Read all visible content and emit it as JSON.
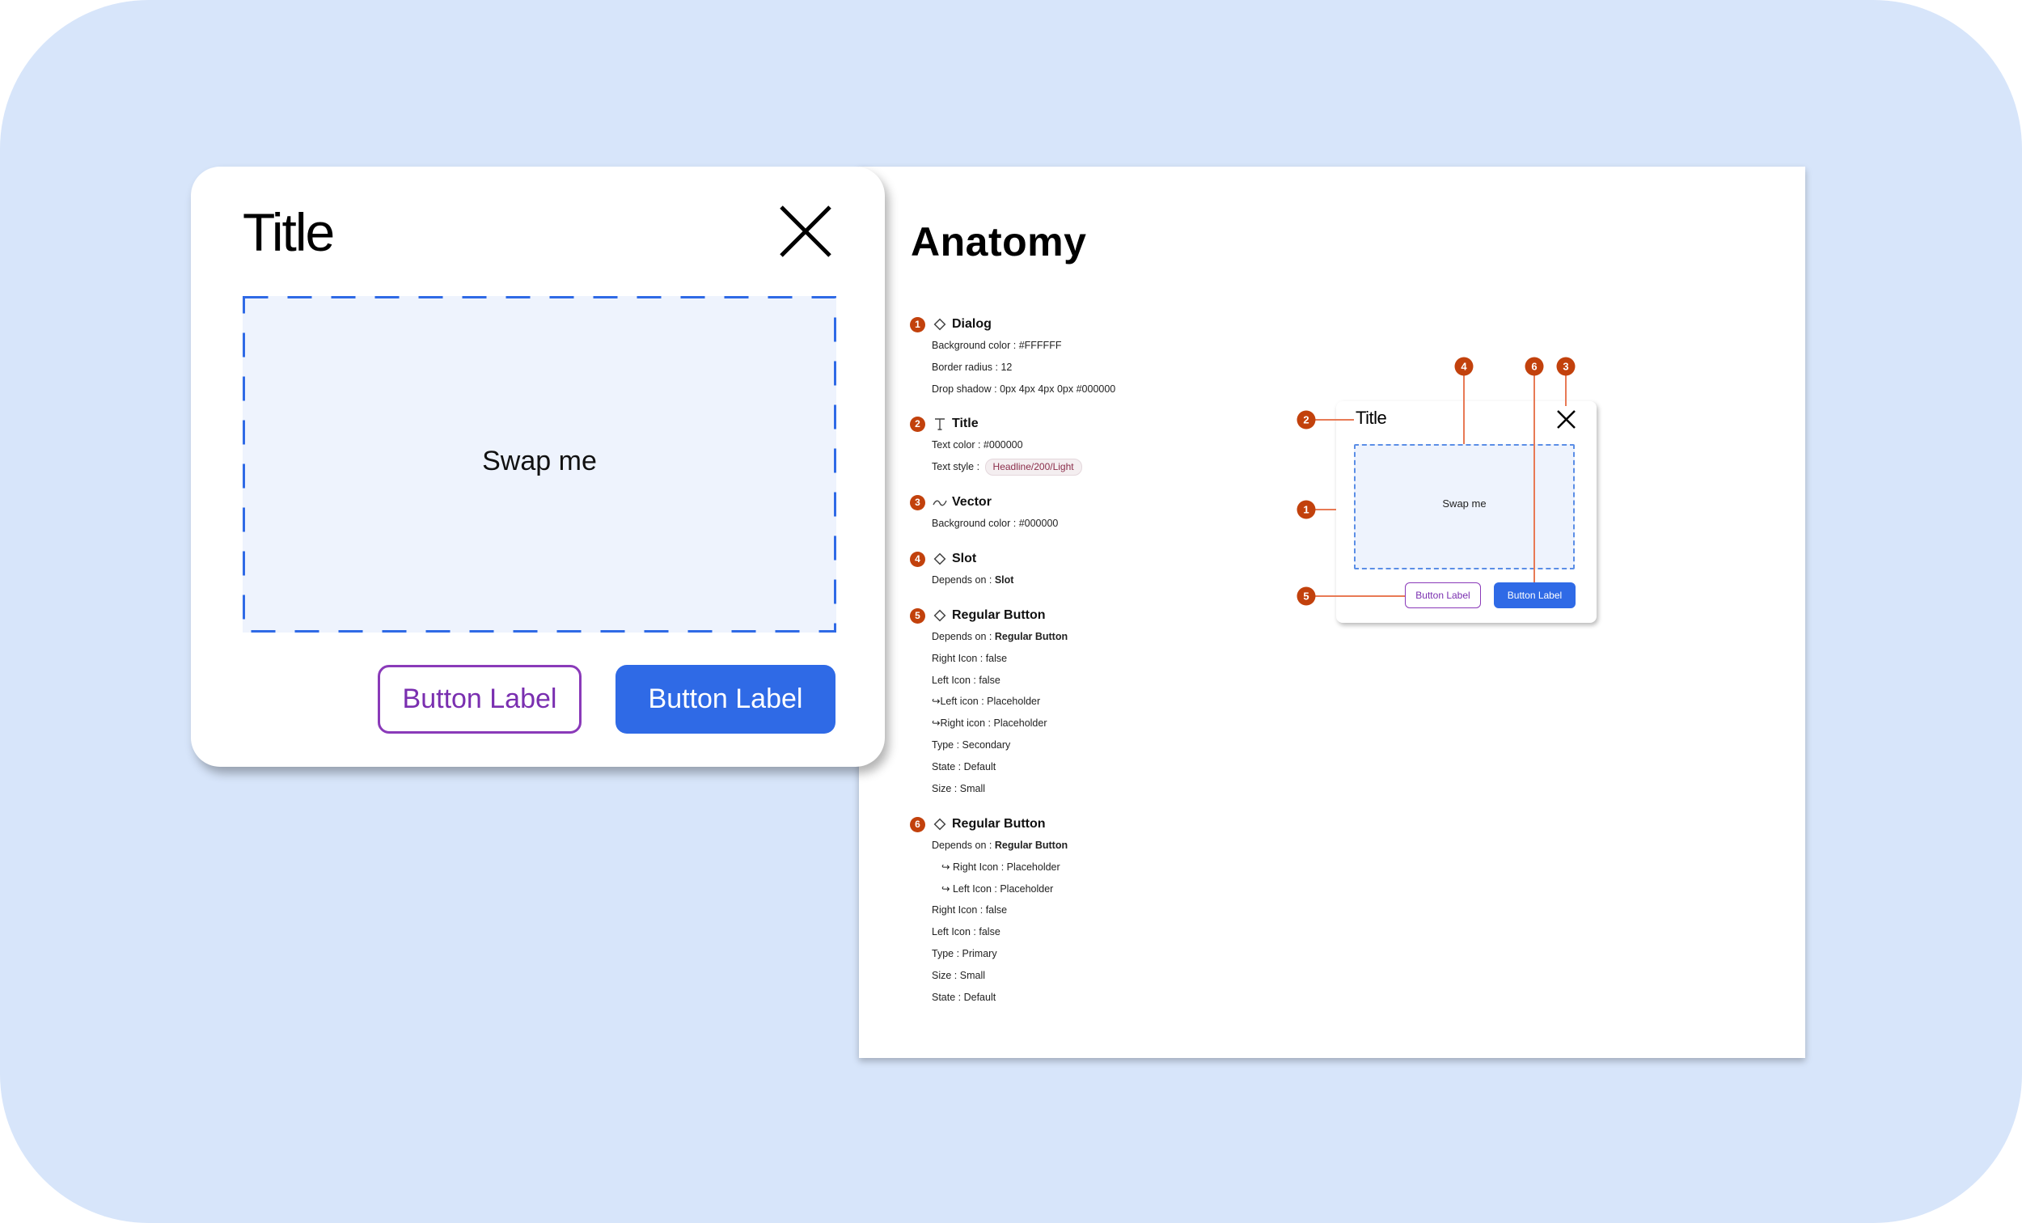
{
  "dialog": {
    "title": "Title",
    "slot_text": "Swap me",
    "secondary_button": "Button Label",
    "primary_button": "Button Label",
    "close_icon": "close-icon"
  },
  "anatomy": {
    "heading": "Anatomy",
    "sections": [
      {
        "number": "1",
        "icon": "component-diamond-icon",
        "name": "Dialog",
        "props": [
          {
            "label": "Background color : ",
            "value": "#FFFFFF"
          },
          {
            "label": "Border radius : ",
            "value": "12"
          },
          {
            "label": "Drop shadow : ",
            "value": "0px 4px 4px 0px #000000"
          }
        ]
      },
      {
        "number": "2",
        "icon": "text-icon",
        "name": "Title",
        "props": [
          {
            "label": "Text color : ",
            "value": "#000000"
          },
          {
            "label": "Text style : ",
            "chip": "Headline/200/Light"
          }
        ]
      },
      {
        "number": "3",
        "icon": "vector-icon",
        "name": "Vector",
        "props": [
          {
            "label": "Background color : ",
            "value": "#000000"
          }
        ]
      },
      {
        "number": "4",
        "icon": "component-diamond-icon",
        "name": "Slot",
        "props": [
          {
            "label": "Depends on : ",
            "value": "Slot"
          }
        ]
      },
      {
        "number": "5",
        "icon": "component-diamond-icon",
        "name": "Regular Button",
        "props": [
          {
            "label": "Depends on : ",
            "value": "Regular Button"
          },
          {
            "label": "Right Icon : ",
            "value": "false"
          },
          {
            "label": "Left Icon : ",
            "value": "false"
          },
          {
            "label": "↪Left icon : ",
            "value": "Placeholder"
          },
          {
            "label": "↪Right icon : ",
            "value": "Placeholder"
          },
          {
            "label": "Type : ",
            "value": "Secondary"
          },
          {
            "label": "State : ",
            "value": "Default"
          },
          {
            "label": "Size : ",
            "value": "Small"
          }
        ]
      },
      {
        "number": "6",
        "icon": "component-diamond-icon",
        "name": "Regular Button",
        "props": [
          {
            "label": "Depends on : ",
            "value": "Regular Button"
          },
          {
            "label": "↪ Right Icon : ",
            "value": "Placeholder"
          },
          {
            "label": "↪ Left Icon : ",
            "value": "Placeholder"
          },
          {
            "label": "Right Icon : ",
            "value": "false"
          },
          {
            "label": "Left Icon : ",
            "value": "false"
          },
          {
            "label": "Type : ",
            "value": "Primary"
          },
          {
            "label": "Size : ",
            "value": "Small"
          },
          {
            "label": "State : ",
            "value": "Default"
          }
        ]
      }
    ],
    "figure": {
      "title": "Title",
      "slot_text": "Swap me",
      "secondary_button": "Button Label",
      "primary_button": "Button Label",
      "markers": [
        "1",
        "2",
        "3",
        "4",
        "5",
        "6"
      ]
    }
  },
  "colors": {
    "canvas": "#d7e5fa",
    "accent_blue": "#2f6ae6",
    "accent_purple": "#8a3ab9",
    "marker_orange": "#c2410c",
    "slot_fill": "#eef3fd"
  }
}
